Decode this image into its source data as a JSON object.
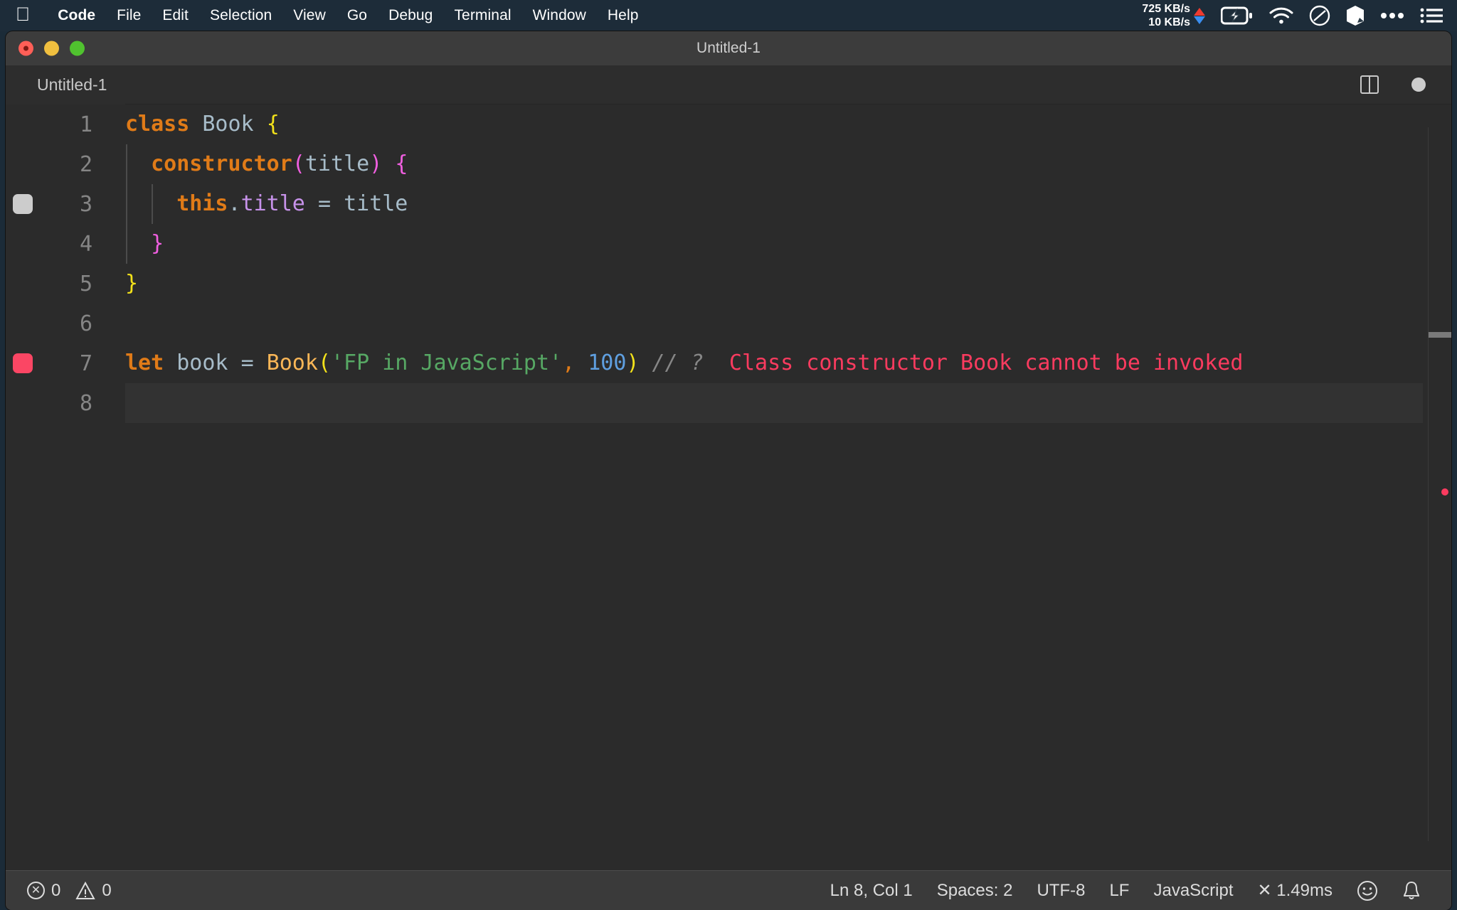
{
  "menubar": {
    "apple_icon": "apple-logo-icon",
    "items": [
      {
        "label": "Code",
        "bold": true
      },
      {
        "label": "File",
        "bold": false
      },
      {
        "label": "Edit",
        "bold": false
      },
      {
        "label": "Selection",
        "bold": false
      },
      {
        "label": "View",
        "bold": false
      },
      {
        "label": "Go",
        "bold": false
      },
      {
        "label": "Debug",
        "bold": false
      },
      {
        "label": "Terminal",
        "bold": false
      },
      {
        "label": "Window",
        "bold": false
      },
      {
        "label": "Help",
        "bold": false
      }
    ],
    "network": {
      "upload": "725 KB/s",
      "download": "10 KB/s",
      "upload_color": "#ee3b30",
      "download_color": "#3a8ef0"
    },
    "status_icons": [
      "battery-charging-icon",
      "wifi-icon",
      "do-not-disturb-icon",
      "box-3d-icon",
      "ellipsis-icon",
      "list-menu-icon"
    ]
  },
  "window": {
    "title": "Untitled-1",
    "traffic_lights": [
      "close-button",
      "minimize-button",
      "maximize-button"
    ]
  },
  "tabbar": {
    "active_tab": "Untitled-1",
    "actions": [
      "split-editor-icon",
      "unsaved-dot-icon"
    ]
  },
  "editor": {
    "lines": [
      {
        "number": "1",
        "breakpoint": "none",
        "current": false,
        "indent_guides": 0,
        "tokens": [
          {
            "t": "class",
            "c": "kw"
          },
          {
            "t": " ",
            "c": "plain"
          },
          {
            "t": "Book",
            "c": "type"
          },
          {
            "t": " ",
            "c": "plain"
          },
          {
            "t": "{",
            "c": "brace-y"
          }
        ]
      },
      {
        "number": "2",
        "breakpoint": "none",
        "current": false,
        "indent_guides": 1,
        "tokens": [
          {
            "t": "  ",
            "c": "plain"
          },
          {
            "t": "constructor",
            "c": "kw"
          },
          {
            "t": "(",
            "c": "brace-m"
          },
          {
            "t": "title",
            "c": "var"
          },
          {
            "t": ")",
            "c": "brace-m"
          },
          {
            "t": " ",
            "c": "plain"
          },
          {
            "t": "{",
            "c": "brace-m"
          }
        ]
      },
      {
        "number": "3",
        "breakpoint": "gray",
        "current": false,
        "indent_guides": 2,
        "tokens": [
          {
            "t": "    ",
            "c": "plain"
          },
          {
            "t": "this",
            "c": "kw"
          },
          {
            "t": ".",
            "c": "var"
          },
          {
            "t": "title",
            "c": "prop"
          },
          {
            "t": " ",
            "c": "plain"
          },
          {
            "t": "=",
            "c": "var"
          },
          {
            "t": " ",
            "c": "plain"
          },
          {
            "t": "title",
            "c": "var"
          }
        ]
      },
      {
        "number": "4",
        "breakpoint": "none",
        "current": false,
        "indent_guides": 1,
        "tokens": [
          {
            "t": "  ",
            "c": "plain"
          },
          {
            "t": "}",
            "c": "brace-m"
          }
        ]
      },
      {
        "number": "5",
        "breakpoint": "none",
        "current": false,
        "indent_guides": 0,
        "tokens": [
          {
            "t": "}",
            "c": "brace-y"
          }
        ]
      },
      {
        "number": "6",
        "breakpoint": "none",
        "current": false,
        "indent_guides": 0,
        "tokens": []
      },
      {
        "number": "7",
        "breakpoint": "pink",
        "current": false,
        "indent_guides": 0,
        "tokens": [
          {
            "t": "let",
            "c": "kw"
          },
          {
            "t": " ",
            "c": "plain"
          },
          {
            "t": "book",
            "c": "var"
          },
          {
            "t": " ",
            "c": "plain"
          },
          {
            "t": "=",
            "c": "var"
          },
          {
            "t": " ",
            "c": "plain"
          },
          {
            "t": "Book",
            "c": "fn"
          },
          {
            "t": "(",
            "c": "brace-y"
          },
          {
            "t": "'FP in JavaScript'",
            "c": "str"
          },
          {
            "t": ",",
            "c": "punct-o"
          },
          {
            "t": " ",
            "c": "plain"
          },
          {
            "t": "100",
            "c": "num"
          },
          {
            "t": ")",
            "c": "brace-y"
          },
          {
            "t": " ",
            "c": "plain"
          },
          {
            "t": "// ?",
            "c": "cmt"
          },
          {
            "t": "  ",
            "c": "plain"
          },
          {
            "t": "Class constructor Book cannot be invoked",
            "c": "err"
          }
        ]
      },
      {
        "number": "8",
        "breakpoint": "none",
        "current": true,
        "indent_guides": 0,
        "tokens": []
      }
    ]
  },
  "statusbar": {
    "errors": "0",
    "warnings": "0",
    "error_icon": "error-circle-icon",
    "warning_icon": "warning-triangle-icon",
    "position": "Ln 8, Col 1",
    "indentation": "Spaces: 2",
    "encoding": "UTF-8",
    "eol": "LF",
    "language": "JavaScript",
    "timing": "✕ 1.49ms",
    "feedback_icon": "smiley-icon",
    "notifications_icon": "bell-icon"
  }
}
